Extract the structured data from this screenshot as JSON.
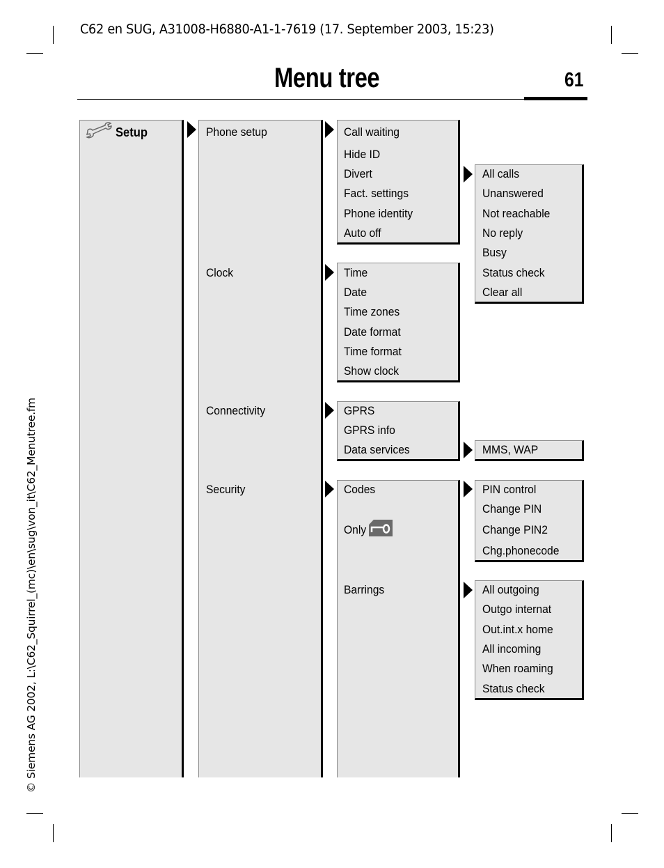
{
  "document": {
    "header": "C62 en SUG, A31008-H6880-A1-1-7619 (17. September 2003, 15:23)",
    "title": "Menu tree",
    "page_number": "61",
    "side_note": "© Siemens AG 2002, L:\\C62_Squirrel_(mc)\\en\\sug\\von_it\\C62_Menutree.fm"
  },
  "icons": {
    "setup": "wrench-icon",
    "arrow": "triangle-right-icon",
    "key": "key-icon"
  },
  "menu": {
    "root": "Setup",
    "level1": [
      "Phone setup",
      "Clock",
      "Connectivity",
      "Security"
    ],
    "phone_setup": [
      "Call waiting",
      "Hide ID",
      "Divert",
      "Fact. settings",
      "Phone identity",
      "Auto off"
    ],
    "divert": [
      "All calls",
      "Unanswered",
      "Not reachable",
      "No reply",
      "Busy",
      "Status check",
      "Clear all"
    ],
    "clock": [
      "Time",
      "Date",
      "Time zones",
      "Date format",
      "Time format",
      "Show clock"
    ],
    "connectivity": [
      "GPRS",
      "GPRS info",
      "Data services"
    ],
    "data_services": [
      "MMS, WAP"
    ],
    "security": [
      "Codes",
      "Only",
      "Barrings"
    ],
    "codes": [
      "PIN control",
      "Change PIN",
      "Change PIN2",
      "Chg.phonecode"
    ],
    "barrings": [
      "All outgoing",
      "Outgo internat",
      "Out.int.x home",
      "All incoming",
      "When roaming",
      "Status check"
    ]
  }
}
